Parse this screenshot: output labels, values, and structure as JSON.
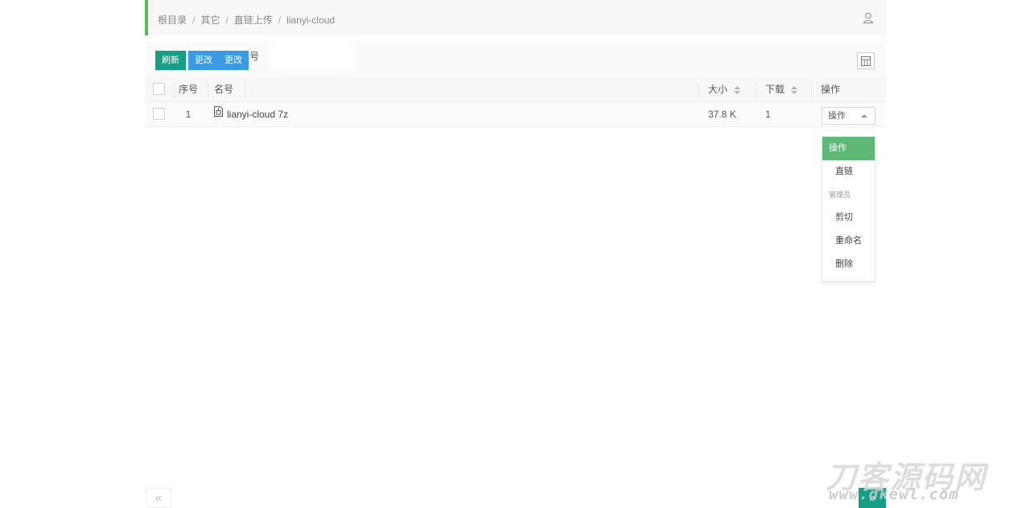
{
  "breadcrumb": {
    "items": [
      "根目录",
      "其它",
      "直链上传",
      "lianyi-cloud"
    ],
    "separator": "/"
  },
  "header": {
    "user_icon": "user-icon"
  },
  "toolbar": {
    "refresh_label": "刷新",
    "change_label": "更改",
    "change2_label": "更改",
    "ghost_text": "号"
  },
  "table": {
    "columns": {
      "index": "序号",
      "name": "名号",
      "size": "大小",
      "downloads": "下载",
      "ops": "操作"
    },
    "rows": [
      {
        "index": "1",
        "name": "lianyi-cloud 7z",
        "size": "37.8 K",
        "downloads": "1",
        "op_label": "操作"
      }
    ]
  },
  "menu": {
    "header": "操作",
    "items_top": [
      "直链"
    ],
    "group_label": "管理员",
    "items_admin": [
      "剪切",
      "重命名",
      "删除"
    ]
  },
  "pager": {
    "prev": "«",
    "next": "»"
  },
  "watermark": {
    "main": "刀客源码网",
    "sub": "www.dkewl.com"
  },
  "colors": {
    "accent_green": "#5fb878",
    "teal": "#169f86",
    "blue": "#3a9be0"
  }
}
